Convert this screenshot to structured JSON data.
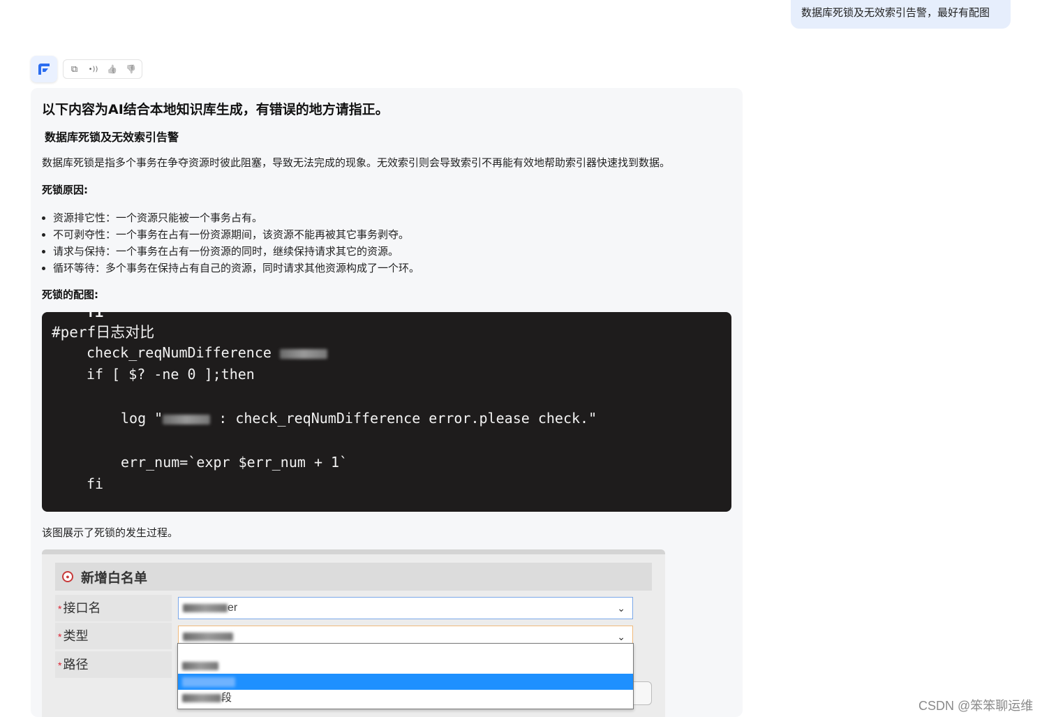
{
  "user_message": "数据库死锁及无效索引告警，最好有配图",
  "toolbar": {
    "avatar_icon": "assistant-logo-icon",
    "buttons": [
      {
        "name": "copy",
        "icon": "copy-icon",
        "glyph": "⧉"
      },
      {
        "name": "read-aloud",
        "icon": "speaker-icon",
        "glyph": "•))"
      },
      {
        "name": "like",
        "icon": "thumbs-up-icon",
        "glyph": "👍"
      },
      {
        "name": "dislike",
        "icon": "thumbs-down-icon",
        "glyph": "👎"
      }
    ]
  },
  "answer": {
    "notice": "以下内容为AI结合本地知识库生成，有错误的地方请指正。",
    "title": "数据库死锁及无效索引告警",
    "intro": "数据库死锁是指多个事务在争夺资源时彼此阻塞，导致无法完成的现象。无效索引则会导致索引不再能有效地帮助索引器快速找到数据。",
    "causes_heading": "死锁原因:",
    "causes": [
      "资源排它性：一个资源只能被一个事务占有。",
      "不可剥夺性：一个事务在占有一份资源期间，该资源不能再被其它事务剥夺。",
      "请求与保持：一个事务在占有一份资源的同时，继续保持请求其它的资源。",
      "循环等待：多个事务在保持占有自己的资源，同时请求其他资源构成了一个环。"
    ],
    "figure_heading": "死锁的配图:",
    "code_image": {
      "top_partial": "fi",
      "comment": "#perf日志对比",
      "line_check": "check_reqNumDifference",
      "line_if": "if [ $? -ne 0 ];then",
      "line_log_prefix": "log \"",
      "line_log_suffix": ": check_reqNumDifference error.please check.\"",
      "line_err": "err_num=`expr $err_num + 1`",
      "line_fi": "fi"
    },
    "caption": "该图展示了死锁的发生过程。",
    "form_image": {
      "title": "新增白名单",
      "required_mark": "*",
      "fields": [
        {
          "label": "接口名",
          "value": "er"
        },
        {
          "label": "类型",
          "value": ""
        },
        {
          "label": "路径",
          "value": ""
        }
      ],
      "dropdown_options": [
        "",
        "",
        "段"
      ]
    }
  },
  "watermark": "CSDN @笨笨聊运维"
}
